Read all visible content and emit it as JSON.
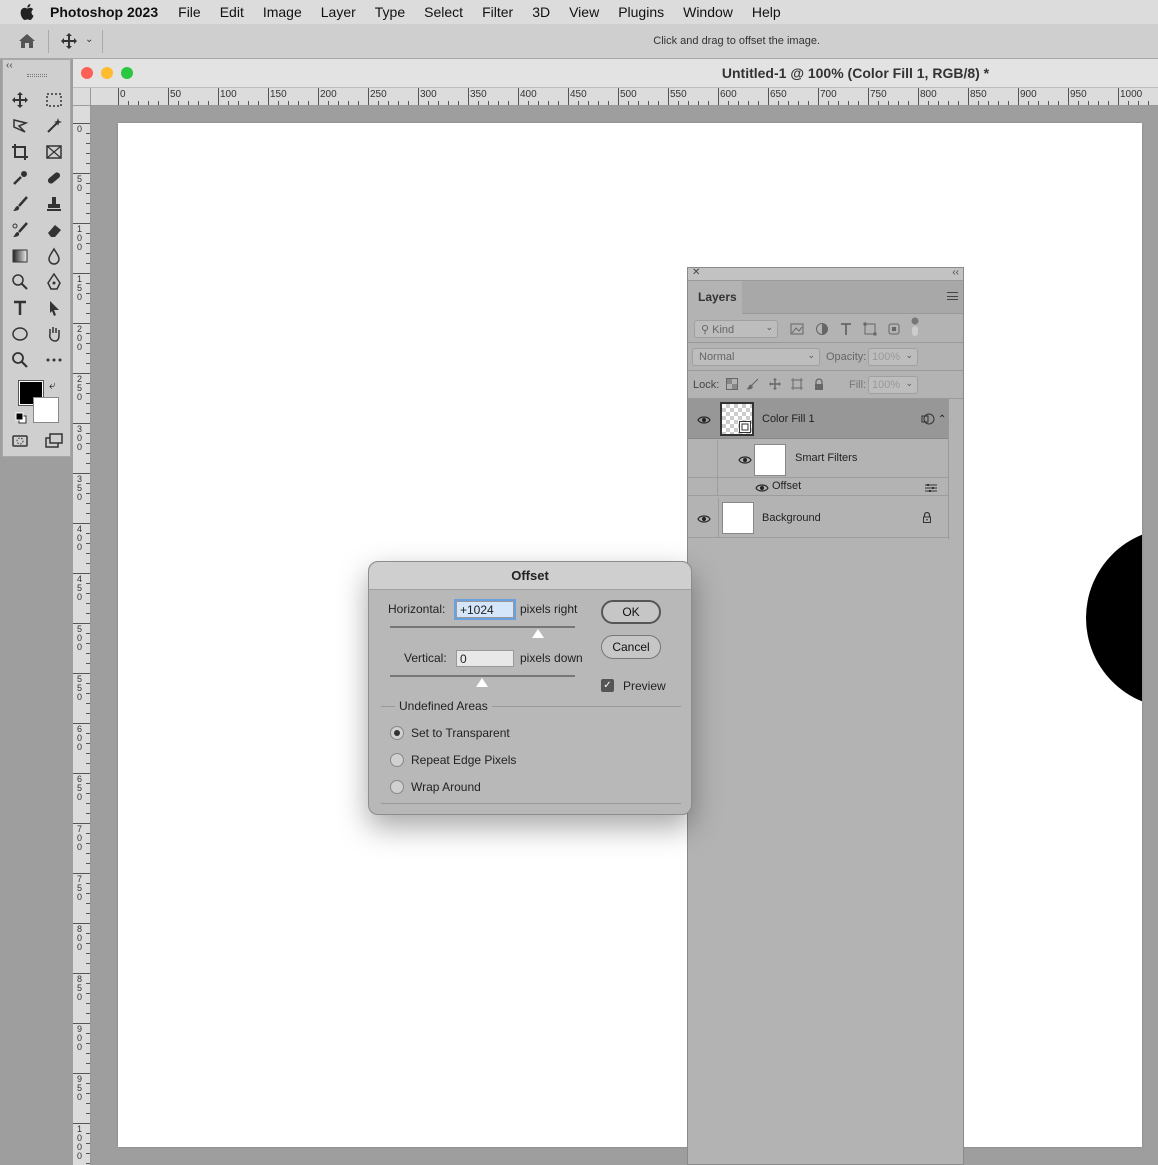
{
  "menubar": {
    "app_name": "Photoshop 2023",
    "items": [
      "File",
      "Edit",
      "Image",
      "Layer",
      "Type",
      "Select",
      "Filter",
      "3D",
      "View",
      "Plugins",
      "Window",
      "Help"
    ]
  },
  "options_bar": {
    "hint": "Click and drag to offset the image."
  },
  "document": {
    "title": "Untitled-1 @ 100% (Color Fill 1, RGB/8) *",
    "ruler_h": [
      "0",
      "50",
      "100",
      "150",
      "200",
      "250",
      "300",
      "350",
      "400",
      "450",
      "500",
      "550",
      "600",
      "650",
      "700",
      "750",
      "800",
      "850",
      "900",
      "950",
      "1000"
    ],
    "ruler_v": [
      "0",
      "50",
      "100",
      "150",
      "200",
      "250",
      "300",
      "350",
      "400",
      "450",
      "500",
      "550",
      "600",
      "650",
      "700",
      "750",
      "800",
      "850",
      "900",
      "950",
      "1000"
    ]
  },
  "colors": {
    "foreground": "#000000",
    "background": "#ffffff",
    "close": "#fe5f57",
    "minimize": "#febc2e",
    "zoom": "#28c840"
  },
  "layers_panel": {
    "tab": "Layers",
    "filter_kind": "Kind",
    "blend_mode": "Normal",
    "opacity_label": "Opacity:",
    "opacity_value": "100%",
    "lock_label": "Lock:",
    "fill_label": "Fill:",
    "fill_value": "100%",
    "layers": [
      {
        "name": "Color Fill 1",
        "selected": true
      },
      {
        "name": "Smart Filters"
      },
      {
        "name": "Offset"
      },
      {
        "name": "Background",
        "locked": true
      }
    ]
  },
  "offset_dialog": {
    "title": "Offset",
    "horizontal_label": "Horizontal:",
    "horizontal_value": "+1024",
    "horizontal_unit": "pixels right",
    "vertical_label": "Vertical:",
    "vertical_value": "0",
    "vertical_unit": "pixels down",
    "ok_label": "OK",
    "cancel_label": "Cancel",
    "preview_label": "Preview",
    "preview_checked": true,
    "undefined_areas_label": "Undefined Areas",
    "options": [
      {
        "label": "Set to Transparent",
        "selected": true
      },
      {
        "label": "Repeat Edge Pixels",
        "selected": false
      },
      {
        "label": "Wrap Around",
        "selected": false
      }
    ]
  }
}
